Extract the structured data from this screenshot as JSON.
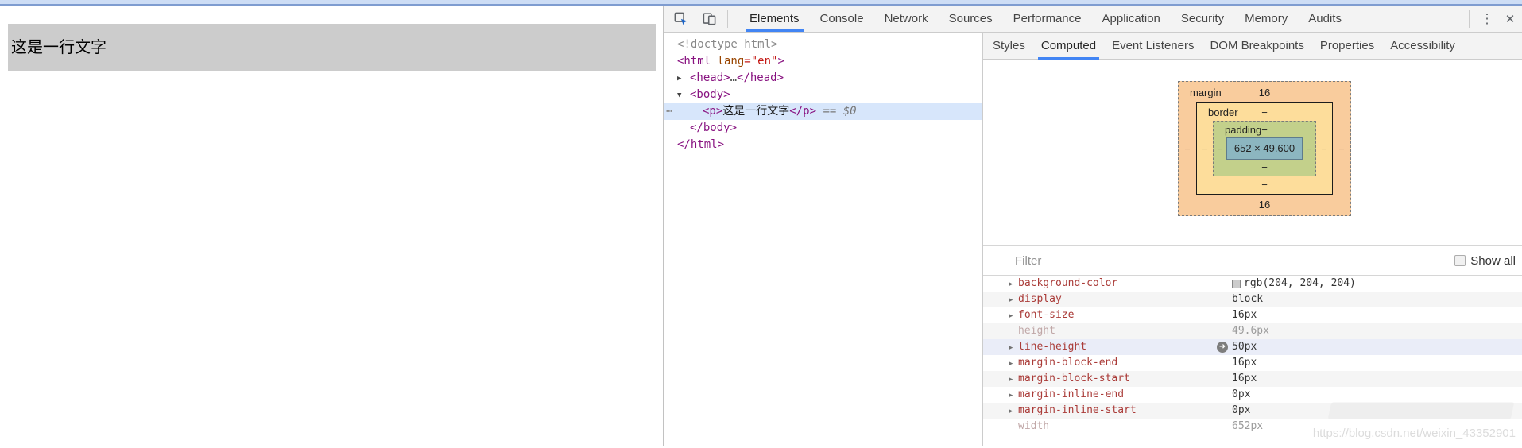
{
  "page": {
    "paragraph_text": "这是一行文字"
  },
  "devtools": {
    "main_tabs": [
      "Elements",
      "Console",
      "Network",
      "Sources",
      "Performance",
      "Application",
      "Security",
      "Memory",
      "Audits"
    ],
    "active_main_tab": "Elements",
    "kebab": "⋮",
    "close": "✕",
    "dom_tree": {
      "gutter_dots": "⋯",
      "arrow_collapsed": "▶",
      "arrow_expanded": "▼",
      "doctype": "<!doctype html>",
      "html_open": "<html ",
      "html_attr": "lang",
      "html_eq": "=\"",
      "html_value": "en",
      "html_q": "\"",
      "html_gt": ">",
      "head_open": "<head>",
      "head_ellipsis": "…",
      "head_close": "</head>",
      "body_open": "<body>",
      "p_open": "<p>",
      "p_text": "这是一行文字",
      "p_close": "</p>",
      "p_annotation": " == $0",
      "body_close": "</body>",
      "html_close": "</html>"
    },
    "sidebar": {
      "tabs": [
        "Styles",
        "Computed",
        "Event Listeners",
        "DOM Breakpoints",
        "Properties",
        "Accessibility"
      ],
      "active_tab": "Computed",
      "box_model": {
        "margin_label": "margin",
        "border_label": "border",
        "padding_label": "padding",
        "content_text": "652 × 49.600",
        "margin_top": "16",
        "margin_bottom": "16",
        "margin_left": "−",
        "margin_right": "−",
        "border_top": "−",
        "border_bottom": "−",
        "border_left": "−",
        "border_right": "−",
        "padding_top": "−",
        "padding_bottom": "−",
        "padding_left": "−",
        "padding_right": "−"
      },
      "filter": {
        "label": "Filter",
        "show_all_label": "Show all",
        "show_all_checked": false
      },
      "properties": [
        {
          "name": "background-color",
          "value": "rgb(204, 204, 204)",
          "swatch": "#cccccc"
        },
        {
          "name": "display",
          "value": "block"
        },
        {
          "name": "font-size",
          "value": "16px"
        },
        {
          "name": "height",
          "value": "49.6px",
          "grayed": true
        },
        {
          "name": "line-height",
          "value": "50px",
          "highlighted": true
        },
        {
          "name": "margin-block-end",
          "value": "16px"
        },
        {
          "name": "margin-block-start",
          "value": "16px"
        },
        {
          "name": "margin-inline-end",
          "value": "0px"
        },
        {
          "name": "margin-inline-start",
          "value": "0px"
        },
        {
          "name": "width",
          "value": "652px",
          "grayed": true
        }
      ]
    }
  },
  "watermark": {
    "url": "https://blog.csdn.net/weixin_43352901"
  },
  "colors": {
    "accent_blue": "#4285f4",
    "selection_blue": "#d7e6fb",
    "paragraph_bg": "#cccccc",
    "box_margin": "#f9cc9d",
    "box_border": "#fddd9b",
    "box_padding": "#c3d08b",
    "box_content": "#8cb6c0",
    "prop_name_red": "#aa3b38",
    "tag_purple": "#881280"
  }
}
